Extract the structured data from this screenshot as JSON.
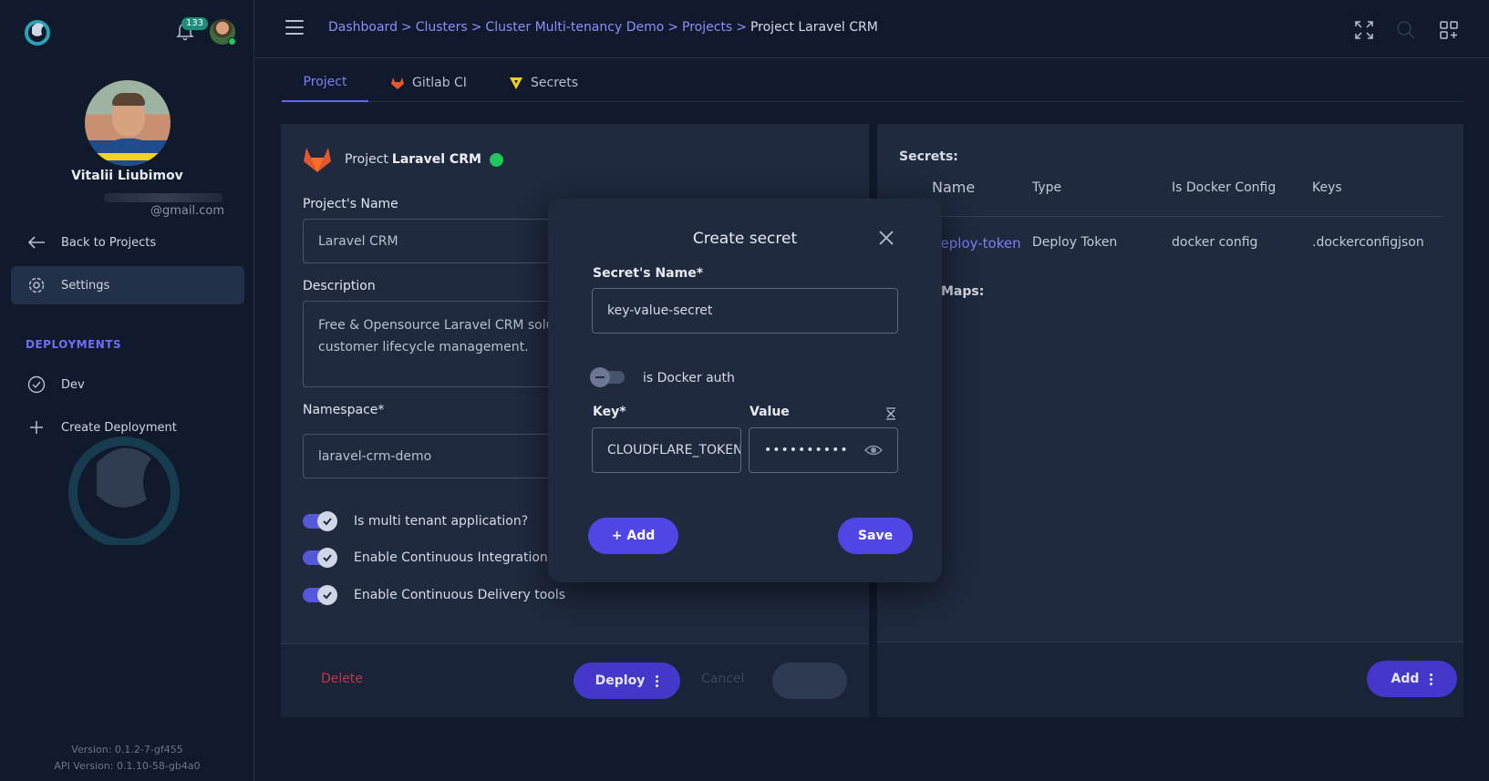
{
  "sidebar": {
    "notification_count": "133",
    "user_name": "Vitalii Liubimov",
    "user_email": "@gmail.com",
    "nav": {
      "back": "Back to Projects",
      "settings": "Settings"
    },
    "deployments_title": "DEPLOYMENTS",
    "deployments": {
      "dev": "Dev",
      "create": "Create Deployment"
    },
    "version": "Version: 0.1.2-7-gf455",
    "api_version": "API Version: 0.1.10-58-gb4a0"
  },
  "header": {
    "breadcrumb": {
      "dashboard": "Dashboard",
      "clusters": "Clusters",
      "cluster": "Cluster Multi-tenancy Demo",
      "projects": "Projects",
      "current": "Project Laravel CRM"
    },
    "separator": ">"
  },
  "tabs": {
    "project": "Project",
    "gitlab": "Gitlab CI",
    "secrets": "Secrets"
  },
  "project_card": {
    "head_prefix": "Project",
    "head_name": "Laravel CRM",
    "name_label": "Project's Name",
    "name_value": "Laravel CRM",
    "description_label": "Description",
    "description_line1": "Free & Opensource Laravel CRM solut",
    "description_line2": "customer lifecycle management.",
    "namespace_label": "Namespace*",
    "namespace_value": "laravel-crm-demo",
    "toggles": {
      "multi_tenant": "Is multi tenant application?",
      "ci": "Enable Continuous Integration to",
      "cd": "Enable Continuous Delivery tools"
    },
    "footer": {
      "delete": "Delete",
      "deploy": "Deploy",
      "cancel": "Cancel"
    }
  },
  "secrets_card": {
    "title": "Secrets:",
    "columns": {
      "name": "Name",
      "type": "Type",
      "docker": "Is Docker Config",
      "keys": "Keys"
    },
    "row": {
      "name": "deploy-token",
      "type": "Deploy Token",
      "docker": "docker config",
      "keys": ".dockerconfigjson"
    },
    "maps_title": "Maps:",
    "add": "Add"
  },
  "modal": {
    "title": "Create secret",
    "secret_name_label": "Secret's Name*",
    "secret_name_value": "key-value-secret",
    "docker_auth_label": "is Docker auth",
    "key_label": "Key*",
    "key_value": "CLOUDFLARE_TOKEN",
    "value_label": "Value",
    "value_masked": "••••••••••",
    "add_button": "+ Add",
    "save_button": "Save"
  },
  "colors": {
    "accent": "#6366f1",
    "link": "#7b7ff7",
    "status_green": "#22c55e",
    "danger": "#c2364a",
    "background": "#111a2c",
    "card": "#1f2a3f"
  }
}
